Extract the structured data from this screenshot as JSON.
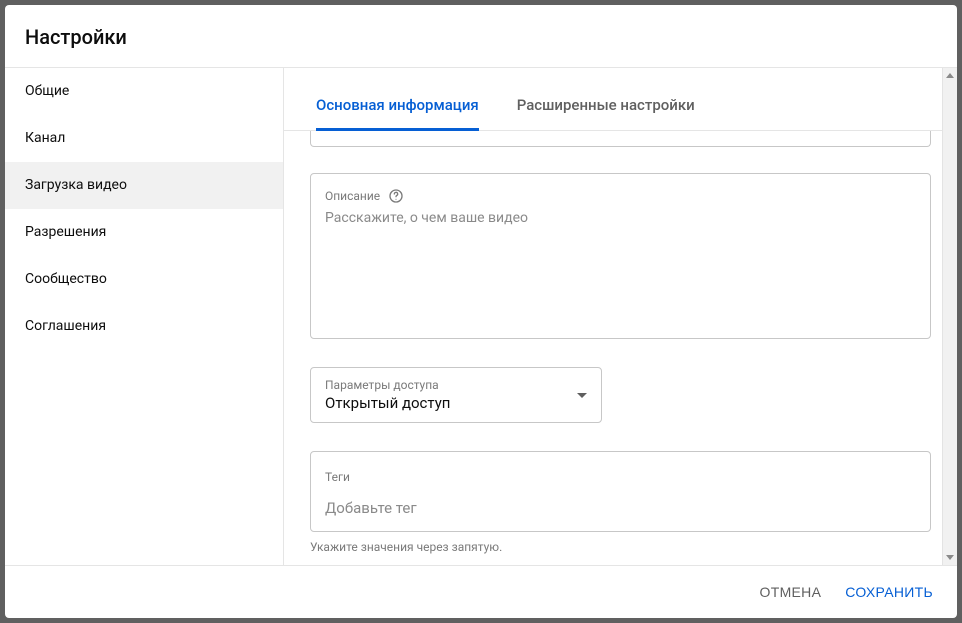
{
  "header": {
    "title": "Настройки"
  },
  "sidebar": {
    "items": [
      {
        "label": "Общие"
      },
      {
        "label": "Канал"
      },
      {
        "label": "Загрузка видео"
      },
      {
        "label": "Разрешения"
      },
      {
        "label": "Сообщество"
      },
      {
        "label": "Соглашения"
      }
    ],
    "selected_index": 2
  },
  "tabs": {
    "items": [
      {
        "label": "Основная информация"
      },
      {
        "label": "Расширенные настройки"
      }
    ],
    "active_index": 0
  },
  "form": {
    "description": {
      "label": "Описание",
      "placeholder": "Расскажите, о чем ваше видео",
      "value": ""
    },
    "privacy": {
      "label": "Параметры доступа",
      "value": "Открытый доступ"
    },
    "tags": {
      "label": "Теги",
      "placeholder": "Добавьте тег",
      "helper": "Укажите значения через запятую."
    }
  },
  "footer": {
    "cancel": "ОТМЕНА",
    "save": "СОХРАНИТЬ"
  }
}
